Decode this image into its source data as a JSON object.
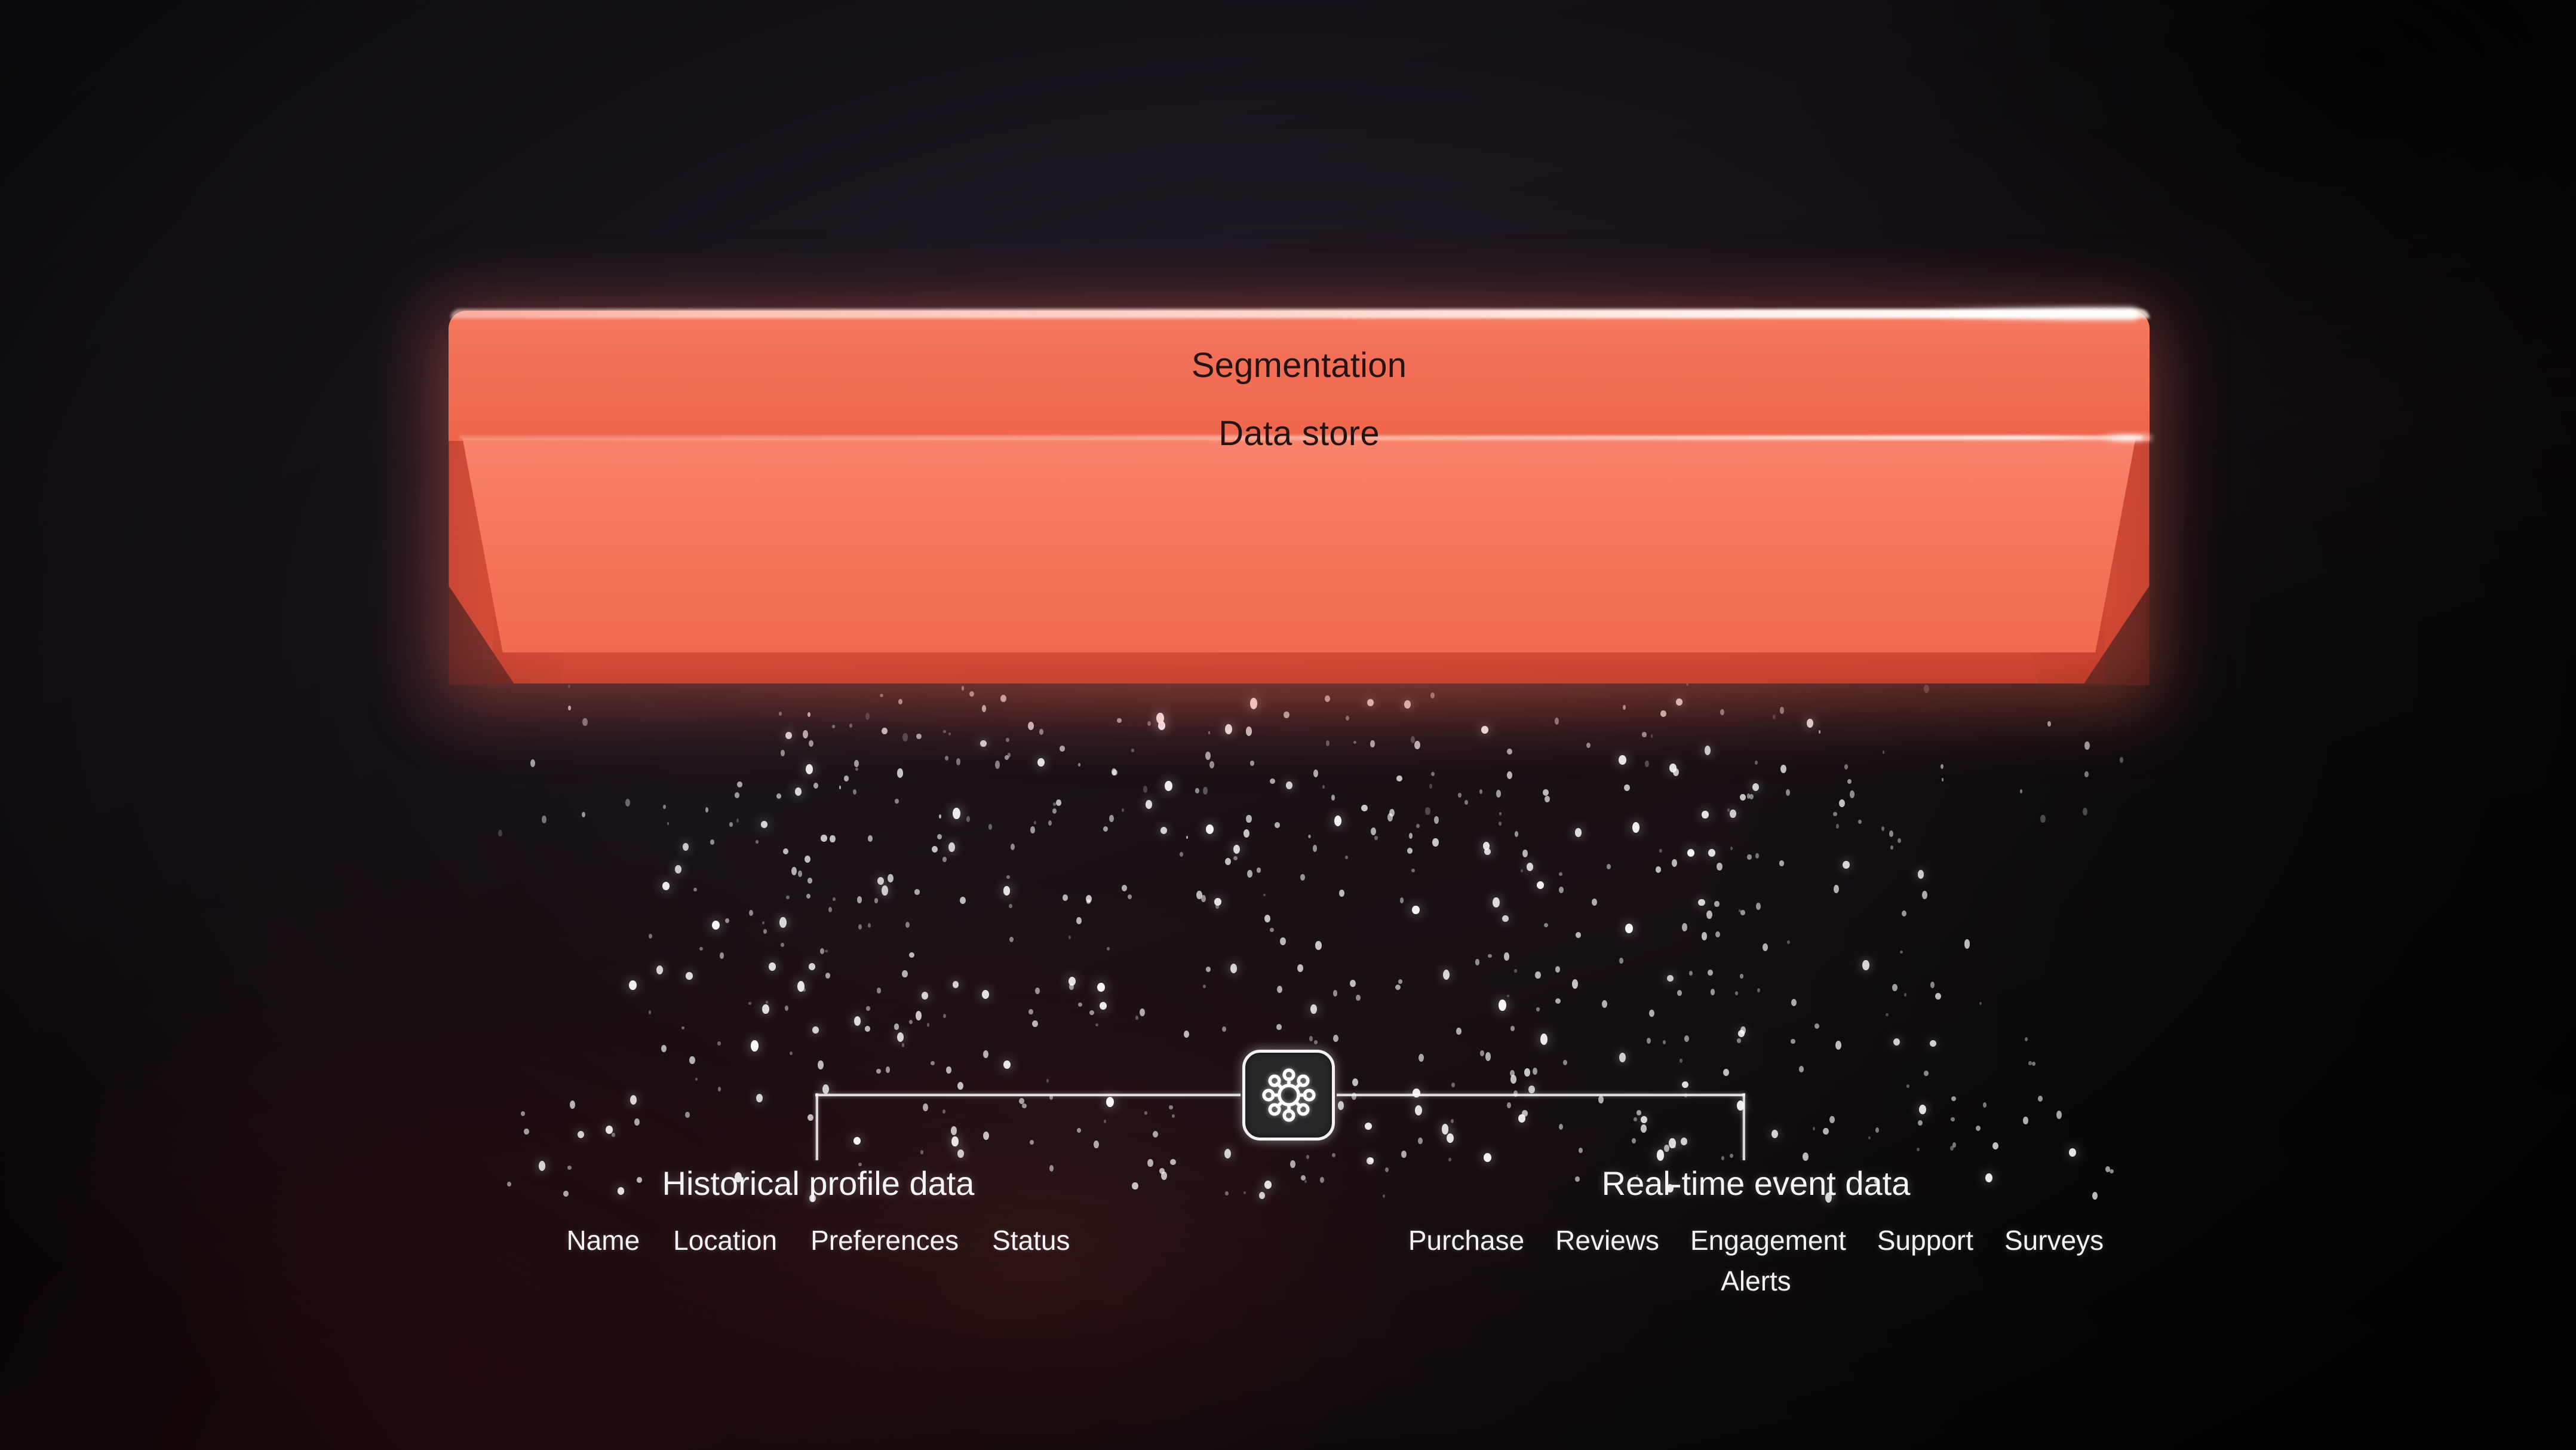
{
  "slab": {
    "top_label": "Segmentation",
    "bottom_label": "Data store",
    "color": "#f06a50",
    "top_face_color": "#f17158",
    "inner_face_color": "#f67d64",
    "label_color": "#241312"
  },
  "hub": {
    "icon": "network-hub-icon",
    "glow_color": "#ffffff"
  },
  "groups": [
    {
      "id": "historical-profile-data",
      "title": "Historical profile data",
      "items": [
        "Name",
        "Location",
        "Preferences",
        "Status"
      ]
    },
    {
      "id": "real-time-event-data",
      "title": "Real-time event data",
      "items": [
        "Purchase",
        "Reviews",
        "Engagement",
        "Support",
        "Surveys",
        "Alerts"
      ]
    }
  ],
  "background": {
    "top_left": "#1e1822",
    "bottom_left": "#2a1418",
    "bottom_right": "#0d0c0e",
    "particle_color": "#ffffff"
  }
}
